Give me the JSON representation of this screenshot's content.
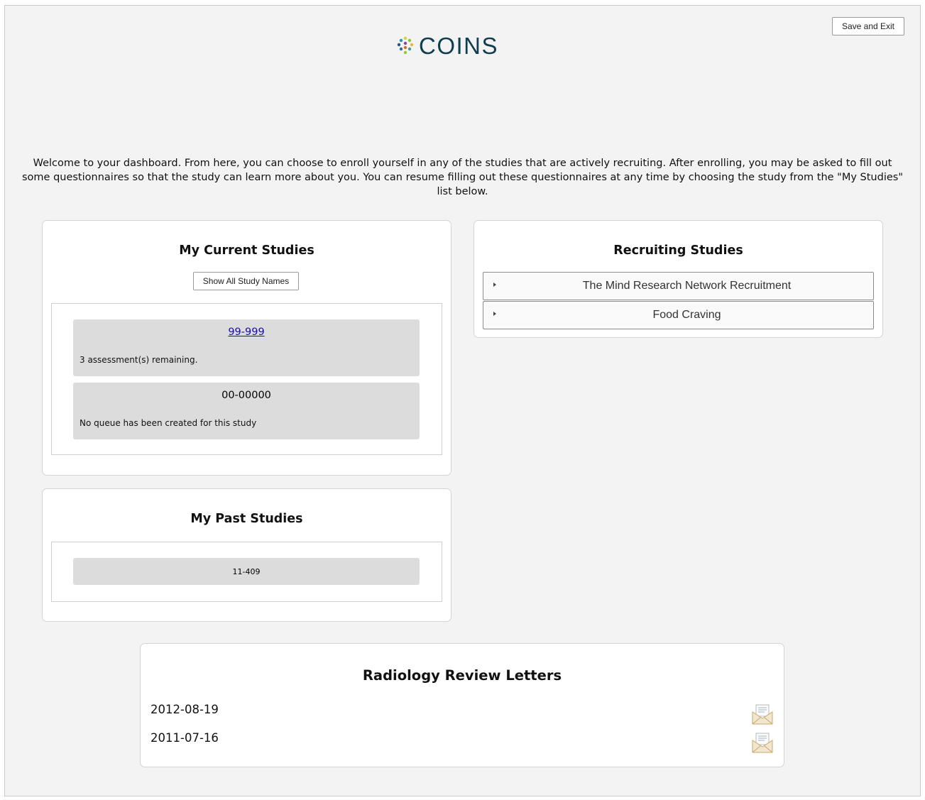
{
  "header": {
    "save_exit_label": "Save and Exit",
    "logo_text": "COINS"
  },
  "welcome_text": "Welcome to your dashboard. From here, you can choose to enroll yourself in any of the studies that are actively recruiting. After enrolling, you may be asked to fill out some questionnaires so that the study can learn more about you. You can resume filling out these questionnaires at any time by choosing the study from the \"My Studies\" list below.",
  "current_studies": {
    "title": "My Current Studies",
    "show_all_label": "Show All Study Names",
    "items": [
      {
        "id": "99-999",
        "note": "3 assessment(s) remaining."
      },
      {
        "id": "00-00000",
        "note": "No queue has been created for this study"
      }
    ]
  },
  "past_studies": {
    "title": "My Past Studies",
    "items": [
      {
        "id": "11-409"
      }
    ]
  },
  "recruiting": {
    "title": "Recruiting Studies",
    "items": [
      {
        "label": "The Mind Research Network Recruitment"
      },
      {
        "label": "Food Craving"
      }
    ]
  },
  "radiology": {
    "title": "Radiology Review Letters",
    "letters": [
      {
        "date": "2012-08-19",
        "icon": "envelope-letter-icon"
      },
      {
        "date": "2011-07-16",
        "icon": "envelope-letter-icon"
      }
    ]
  },
  "colors": {
    "background": "#f3f3f3",
    "logo_text": "#0f3e50",
    "study_card": "#dcdcdc",
    "link": "#1a0dab"
  }
}
